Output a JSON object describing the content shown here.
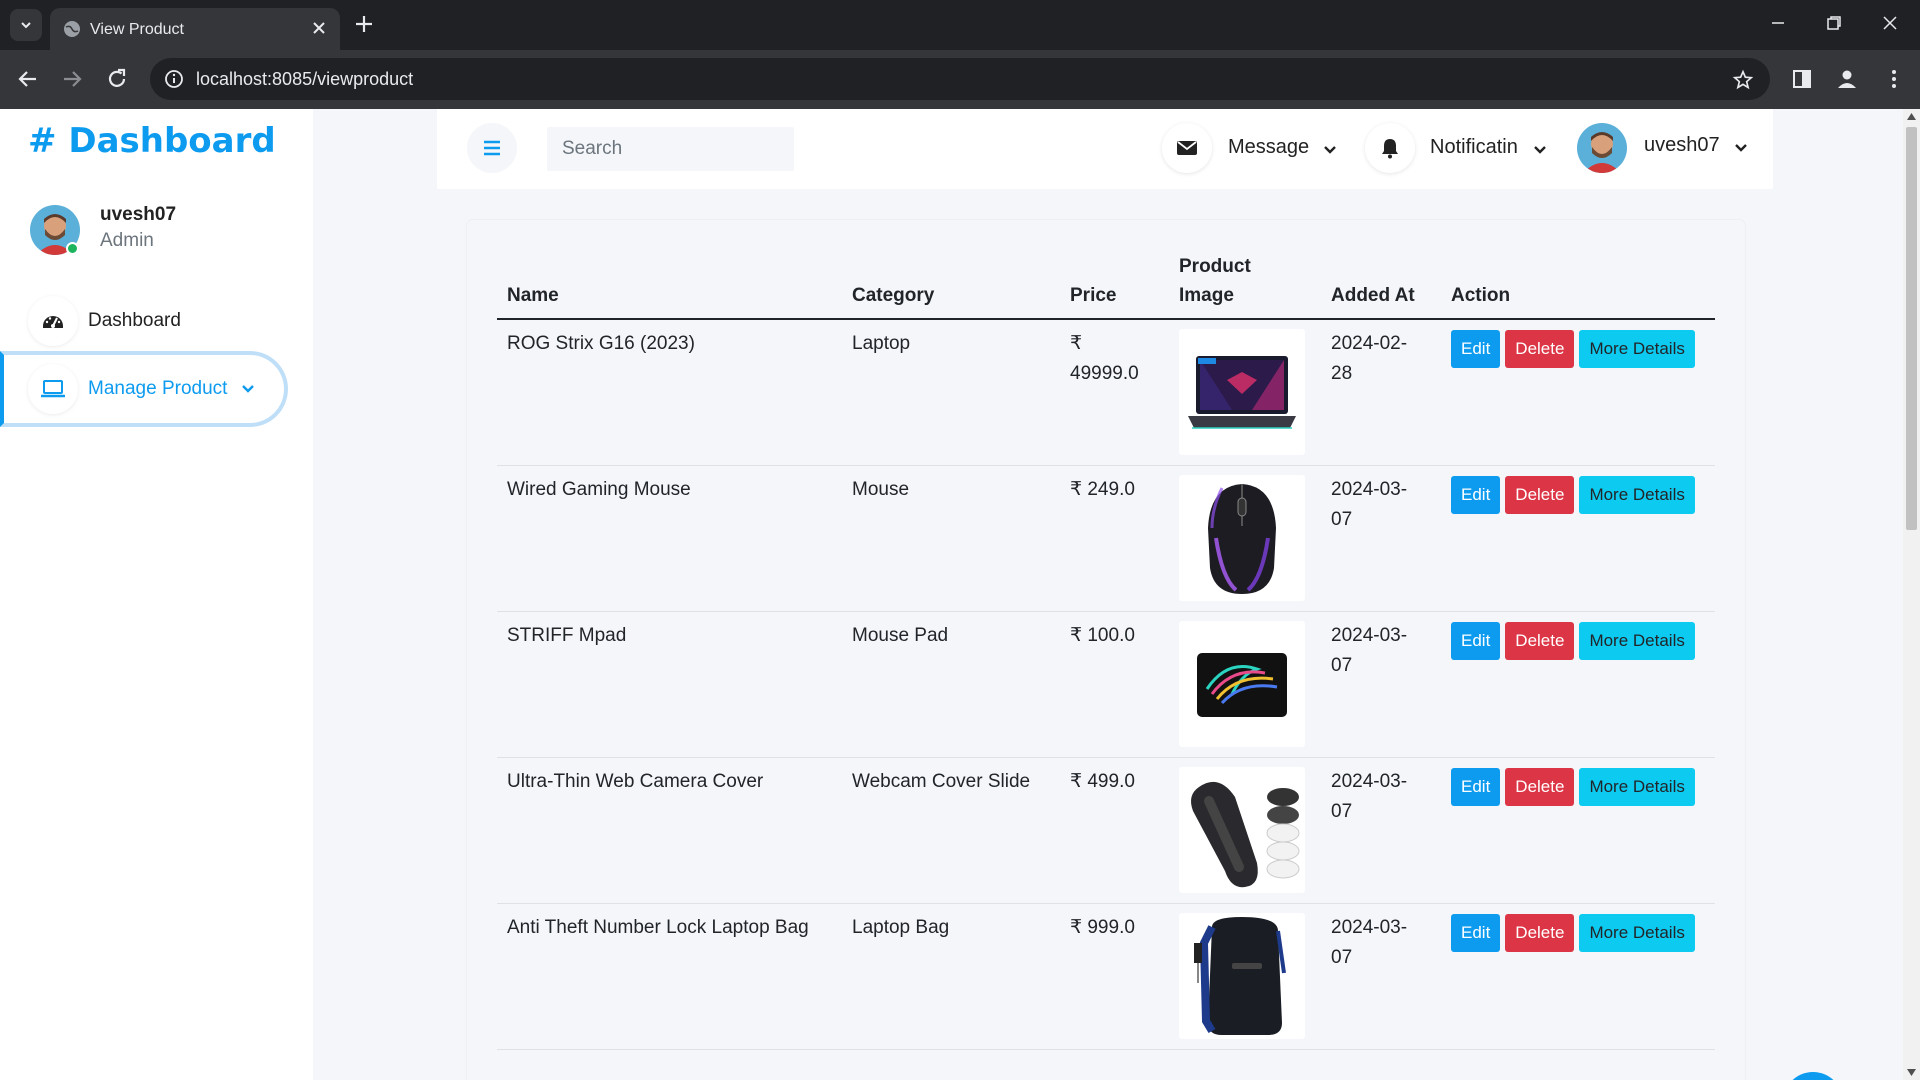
{
  "browser": {
    "tab_title": "View Product",
    "url": "localhost:8085/viewproduct"
  },
  "sidebar": {
    "brand": "Dashboard",
    "brand_hash": "#",
    "user_name": "uvesh07",
    "user_role": "Admin",
    "items": [
      {
        "label": "Dashboard",
        "icon": "speedometer-icon"
      },
      {
        "label": "Manage Product",
        "icon": "laptop-icon",
        "active": true
      }
    ]
  },
  "topbar": {
    "search_placeholder": "Search",
    "message_label": "Message",
    "notification_label": "Notificatin",
    "user_name": "uvesh07"
  },
  "table": {
    "headers": [
      "Name",
      "Category",
      "Price",
      "Product Image",
      "Added At",
      "Action"
    ],
    "rows": [
      {
        "name": "ROG Strix G16 (2023)",
        "category": "Laptop",
        "price": "₹ 49999.0",
        "added_at": "2024-02-28",
        "image": "laptop"
      },
      {
        "name": "Wired Gaming Mouse",
        "category": "Mouse",
        "price": "₹ 249.0",
        "added_at": "2024-03-07",
        "image": "mouse"
      },
      {
        "name": "STRIFF Mpad",
        "category": "Mouse Pad",
        "price": "₹ 100.0",
        "added_at": "2024-03-07",
        "image": "mousepad"
      },
      {
        "name": "Ultra-Thin Web Camera Cover",
        "category": "Webcam Cover Slide",
        "price": "₹ 499.0",
        "added_at": "2024-03-07",
        "image": "webcam-cover"
      },
      {
        "name": "Anti Theft Number Lock Laptop Bag",
        "category": "Laptop Bag",
        "price": "₹ 999.0",
        "added_at": "2024-03-07",
        "image": "backpack"
      }
    ],
    "actions": {
      "edit": "Edit",
      "delete": "Delete",
      "more": "More Details"
    }
  },
  "colors": {
    "primary": "#0d9bf0",
    "danger": "#dc3545",
    "info": "#0dcaf0",
    "online": "#1cb45c"
  }
}
